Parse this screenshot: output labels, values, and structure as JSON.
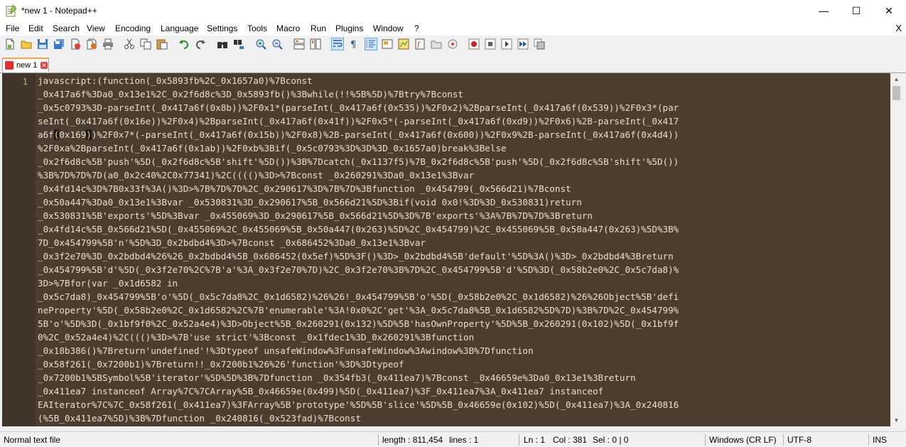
{
  "window": {
    "title": "*new 1 - Notepad++",
    "minimize_glyph": "—",
    "maximize_glyph": "☐",
    "close_glyph": "✕"
  },
  "menu": {
    "items": [
      "File",
      "Edit",
      "Search",
      "View",
      "Encoding",
      "Language",
      "Settings",
      "Tools",
      "Macro",
      "Run",
      "Plugins",
      "Window",
      "?"
    ],
    "close_glyph": "X"
  },
  "toolbar": {
    "icons": [
      "new-file-icon",
      "open-file-icon",
      "save-icon",
      "save-all-icon",
      "close-icon",
      "close-all-icon",
      "print-icon",
      "cut-icon",
      "copy-icon",
      "paste-icon",
      "undo-icon",
      "redo-icon",
      "find-icon",
      "replace-icon",
      "zoom-in-icon",
      "zoom-out-icon",
      "sync-vertical-icon",
      "sync-horizontal-icon",
      "word-wrap-icon",
      "show-all-characters-icon",
      "indent-guide-icon",
      "user-defined-language-icon",
      "document-map-icon",
      "function-list-icon",
      "folder-as-workspace-icon",
      "monitoring-icon",
      "record-macro-icon",
      "stop-recording-icon",
      "playback-macro-icon",
      "run-macro-multiple-icon",
      "save-macro-icon"
    ]
  },
  "tab": {
    "label": "new 1",
    "close_glyph": "✕"
  },
  "editor": {
    "line_number": "1",
    "lines": [
      {
        "pre": "javascript:(function(_0x5893fb%2C_0x1657a0)%7Bconst",
        "hl": "",
        "mid": "",
        "hl2": "",
        "post": ""
      },
      {
        "pre": "_0x417a6f%3Da0_0x13e1%2C_0x2f6d8c%3D_0x5893fb()%3Bwhile(!!%5B%5D)%7Btry%7Bconst",
        "hl": "",
        "mid": "",
        "hl2": "",
        "post": ""
      },
      {
        "pre": "_0x5c0793%3D-parseInt(_0x417a6f(0x8b))%2F0x1*(parseInt(_0x417a6f(0x535))%2F0x2)%2BparseInt(_0x417a6f(0x539))%2F0x3*(par",
        "hl": "",
        "mid": "",
        "hl2": "",
        "post": ""
      },
      {
        "pre": "seInt(_0x417a6f(0x16e))%2F0x4)%2BparseInt(_0x417a6f(0x41f))%2F0x5*(-parseInt(_0x417a6f(0xd9))%2F0x6)%2B-parseInt(_0x417",
        "hl": "",
        "mid": "",
        "hl2": "",
        "post": ""
      },
      {
        "pre": "a6f",
        "hl": "(",
        "mid": "0x169",
        "hl2": ")",
        "post": ")%2F0x7*(-parseInt(_0x417a6f(0x15b))%2F0x8)%2B-parseInt(_0x417a6f(0x600))%2F0x9%2B-parseInt(_0x417a6f(0x4d4))"
      },
      {
        "pre": "%2F0xa%2BparseInt(_0x417a6f(0x1ab))%2F0xb%3Bif(_0x5c0793%3D%3D%3D_0x1657a0)break%3Belse",
        "hl": "",
        "mid": "",
        "hl2": "",
        "post": ""
      },
      {
        "pre": "_0x2f6d8c%5B'push'%5D(_0x2f6d8c%5B'shift'%5D())%3B%7Dcatch(_0x1137f5)%7B_0x2f6d8c%5B'push'%5D(_0x2f6d8c%5B'shift'%5D())",
        "hl": "",
        "mid": "",
        "hl2": "",
        "post": ""
      },
      {
        "pre": "%3B%7D%7D%7D(a0_0x2c40%2C0x77341)%2C(((()%3D>%7Bconst _0x260291%3Da0_0x13e1%3Bvar",
        "hl": "",
        "mid": "",
        "hl2": "",
        "post": ""
      },
      {
        "pre": "_0x4fd14c%3D%7B0x33f%3A()%3D>%7B%7D%7D%2C_0x290617%3D%7B%7D%3Bfunction _0x454799(_0x566d21)%7Bconst",
        "hl": "",
        "mid": "",
        "hl2": "",
        "post": ""
      },
      {
        "pre": "_0x50a447%3Da0_0x13e1%3Bvar _0x530831%3D_0x290617%5B_0x566d21%5D%3Bif(void 0x0!%3D%3D_0x530831)return",
        "hl": "",
        "mid": "",
        "hl2": "",
        "post": ""
      },
      {
        "pre": "_0x530831%5B'exports'%5D%3Bvar _0x455069%3D_0x290617%5B_0x566d21%5D%3D%7B'exports'%3A%7B%7D%7D%3Breturn",
        "hl": "",
        "mid": "",
        "hl2": "",
        "post": ""
      },
      {
        "pre": "_0x4fd14c%5B_0x566d21%5D(_0x455069%2C_0x455069%5B_0x50a447(0x263)%5D%2C_0x454799)%2C_0x455069%5B_0x50a447(0x263)%5D%3B%",
        "hl": "",
        "mid": "",
        "hl2": "",
        "post": ""
      },
      {
        "pre": "7D_0x454799%5B'n'%5D%3D_0x2bdbd4%3D>%7Bconst _0x686452%3Da0_0x13e1%3Bvar",
        "hl": "",
        "mid": "",
        "hl2": "",
        "post": ""
      },
      {
        "pre": "_0x3f2e70%3D_0x2bdbd4%26%26_0x2bdbd4%5B_0x686452(0x5ef)%5D%3F()%3D>_0x2bdbd4%5B'default'%5D%3A()%3D>_0x2bdbd4%3Breturn",
        "hl": "",
        "mid": "",
        "hl2": "",
        "post": ""
      },
      {
        "pre": "_0x454799%5B'd'%5D(_0x3f2e70%2C%7B'a'%3A_0x3f2e70%7D)%2C_0x3f2e70%3B%7D%2C_0x454799%5B'd'%5D%3D(_0x58b2e0%2C_0x5c7da8)%",
        "hl": "",
        "mid": "",
        "hl2": "",
        "post": ""
      },
      {
        "pre": "3D>%7Bfor(var _0x1d6582 in",
        "hl": "",
        "mid": "",
        "hl2": "",
        "post": ""
      },
      {
        "pre": "_0x5c7da8)_0x454799%5B'o'%5D(_0x5c7da8%2C_0x1d6582)%26%26!_0x454799%5B'o'%5D(_0x58b2e0%2C_0x1d6582)%26%26Object%5B'defi",
        "hl": "",
        "mid": "",
        "hl2": "",
        "post": ""
      },
      {
        "pre": "neProperty'%5D(_0x58b2e0%2C_0x1d6582%2C%7B'enumerable'%3A!0x0%2C'get'%3A_0x5c7da8%5B_0x1d6582%5D%7D)%3B%7D%2C_0x454799%",
        "hl": "",
        "mid": "",
        "hl2": "",
        "post": ""
      },
      {
        "pre": "5B'o'%5D%3D(_0x1bf9f0%2C_0x52a4e4)%3D>Object%5B_0x260291(0x132)%5D%5B'hasOwnProperty'%5D%5B_0x260291(0x102)%5D(_0x1bf9f",
        "hl": "",
        "mid": "",
        "hl2": "",
        "post": ""
      },
      {
        "pre": "0%2C_0x52a4e4)%2C((()%3D>%7B'use strict'%3Bconst _0x1fdec1%3D_0x260291%3Bfunction",
        "hl": "",
        "mid": "",
        "hl2": "",
        "post": ""
      },
      {
        "pre": "_0x18b386()%7Breturn'undefined'!%3Dtypeof unsafeWindow%3FunsafeWindow%3Awindow%3B%7Dfunction",
        "hl": "",
        "mid": "",
        "hl2": "",
        "post": ""
      },
      {
        "pre": "_0x58f261(_0x7200b1)%7Breturn!!_0x7200b1%26%26'function'%3D%3Dtypeof",
        "hl": "",
        "mid": "",
        "hl2": "",
        "post": ""
      },
      {
        "pre": "_0x7200b1%5BSymbol%5B'iterator'%5D%5D%3B%7Dfunction _0x354fb3(_0x411ea7)%7Bconst _0x46659e%3Da0_0x13e1%3Breturn",
        "hl": "",
        "mid": "",
        "hl2": "",
        "post": ""
      },
      {
        "pre": "_0x411ea7 instanceof Array%7C%7CArray%5B_0x46659e(0x499)%5D(_0x411ea7)%3F_0x411ea7%3A_0x411ea7 instanceof",
        "hl": "",
        "mid": "",
        "hl2": "",
        "post": ""
      },
      {
        "pre": "EAIterator%7C%7C_0x58f261(_0x411ea7)%3FArray%5B'prototype'%5D%5B'slice'%5D%5B_0x46659e(0x102)%5D(_0x411ea7)%3A_0x240816",
        "hl": "",
        "mid": "",
        "hl2": "",
        "post": ""
      },
      {
        "pre": "(%5B_0x411ea7%5D)%3B%7Dfunction _0x240816(_0x523fad)%7Bconst",
        "hl": "",
        "mid": "",
        "hl2": "",
        "post": ""
      }
    ]
  },
  "statusbar": {
    "file_type": "Normal text file",
    "length": "length : 811,454",
    "lines": "lines : 1",
    "ln": "Ln : 1",
    "col": "Col : 381",
    "sel": "Sel : 0 | 0",
    "eol": "Windows (CR LF)",
    "encoding": "UTF-8",
    "mode": "INS"
  },
  "colors": {
    "editor_bg": "#4b3e30",
    "editor_text": "#e8dfd0",
    "gutter_bg": "#3f352a",
    "line_number": "#c8b070",
    "tab_accent": "#f9a14e"
  }
}
